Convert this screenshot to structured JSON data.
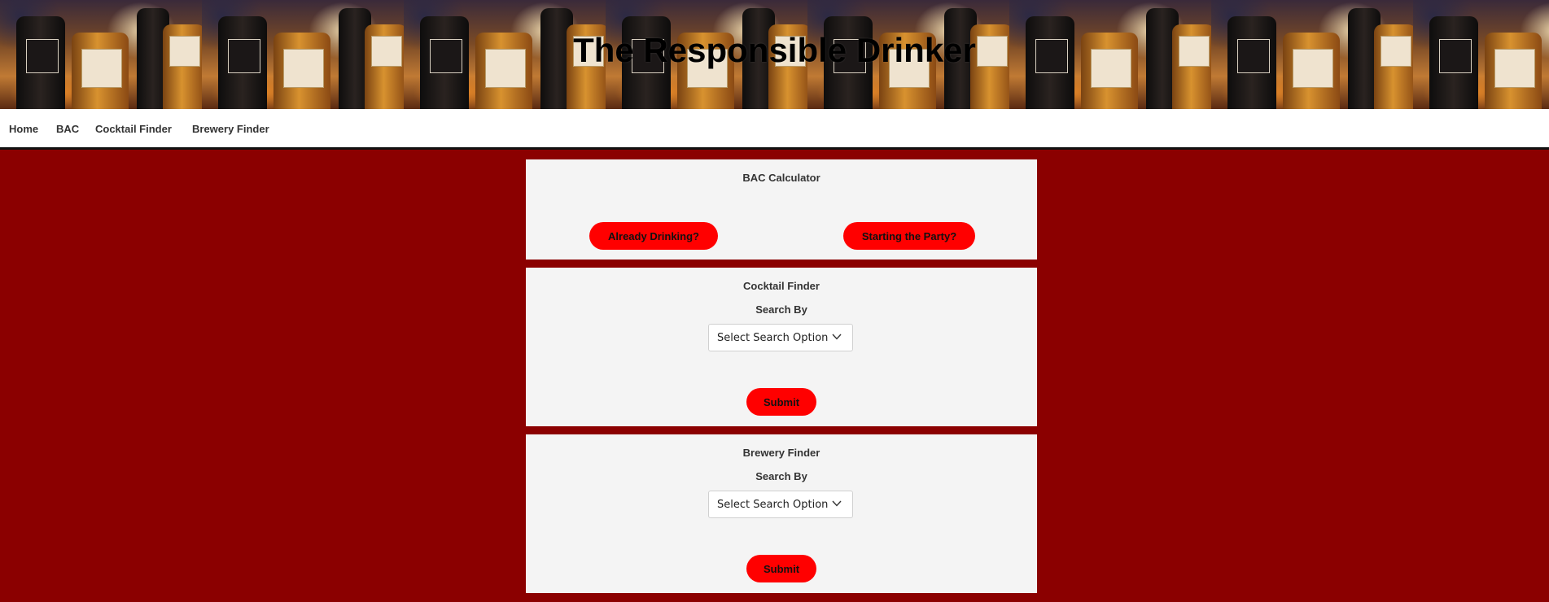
{
  "header": {
    "title": "The Responsible Drinker"
  },
  "nav": {
    "items": [
      {
        "label": "Home"
      },
      {
        "label": "BAC"
      },
      {
        "label": "Cocktail Finder"
      },
      {
        "label": "Brewery Finder"
      }
    ]
  },
  "bac_panel": {
    "title": "BAC Calculator",
    "already_button": "Already Drinking?",
    "starting_button": "Starting the Party?"
  },
  "cocktail_panel": {
    "title": "Cocktail Finder",
    "search_label": "Search By",
    "select_value": "Select Search Option",
    "submit_label": "Submit"
  },
  "brewery_panel": {
    "title": "Brewery Finder",
    "search_label": "Search By",
    "select_value": "Select Search Option",
    "submit_label": "Submit"
  },
  "colors": {
    "page_background": "#8b0000",
    "button_red": "#ff0000",
    "panel_background": "#f4f4f4",
    "navbar_background": "#ffffff"
  },
  "icons": {
    "select_chevron": "chevron-down-icon"
  }
}
